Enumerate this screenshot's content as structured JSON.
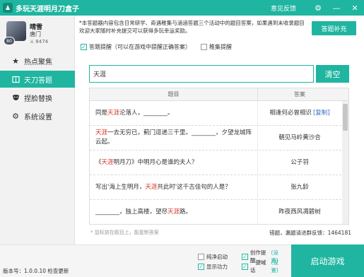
{
  "app": {
    "title": "多玩天涯明月刀盒子",
    "feedback": "意见反馈",
    "settings_icon": "gear-icon",
    "minimize_icon": "minimize-icon",
    "close_icon": "close-icon",
    "accent_color": "#1fb5a0"
  },
  "profile": {
    "name": "晴雪",
    "school": "唐门",
    "score": "8474",
    "level": "80"
  },
  "sidebar": {
    "items": [
      {
        "label": "热点聚焦",
        "icon": "star-icon",
        "active": false
      },
      {
        "label": "天刀答题",
        "icon": "book-icon",
        "active": true
      },
      {
        "label": "捏脸替换",
        "icon": "face-mask-icon",
        "active": false
      },
      {
        "label": "系统设置",
        "icon": "gear-icon",
        "active": false
      }
    ]
  },
  "main": {
    "notice": "*本答题器内容包含日常研学、奇遇稚集与涵涵答题三个活动中的题目答案，如果遇到未收录题目欢迎大家随时补充提交可以获得多玩幸运奖励。",
    "supplement_button": "答题补充",
    "check_answer_hint": "答题提醒（可以在游戏中提醒正确答案）",
    "check_collect": "稚集提醒",
    "search_value": "天涯",
    "clear_button": "清空",
    "table": {
      "col_question": "题目",
      "col_answer": "答案",
      "copy_label": "[复制]",
      "rows": [
        {
          "q_pre": "同是",
          "q_hl": "天涯",
          "q_post": "沦落人，________。",
          "answer": "相逢何必曾相识"
        },
        {
          "q_pre": "",
          "q_hl": "天涯",
          "q_post": "一去无穷已，蓟门逗递三千里。________，夕望龙城阵云起。",
          "answer": "朝见马岭黄沙合"
        },
        {
          "q_pre": "《",
          "q_hl": "天涯",
          "q_post": "明月刀》中明月心是谁的夫人？",
          "answer": "公子羽"
        },
        {
          "q_pre": "写出'海上生明月，",
          "q_hl": "天涯",
          "q_post": "共此时'这千古佳句的人是？",
          "answer": "张九龄"
        },
        {
          "q_pre": "________，独上高楼，望尽",
          "q_hl": "天涯",
          "q_post": "路。",
          "answer": "昨夜西风凋碧树"
        }
      ]
    },
    "hint": "* 鼠标放在题目上，能复制答案",
    "stat": "错题，漏题请进群反馈：1464181"
  },
  "bottom": {
    "version": "版本号：1.0.0.10  检查更新",
    "opt_pure": "纯净启动",
    "opt_power": "显示功力",
    "opt_create": "创作提醒",
    "opt_shout": "一键喊话",
    "settings_label": "(设置)",
    "start_button": "启动游戏"
  }
}
